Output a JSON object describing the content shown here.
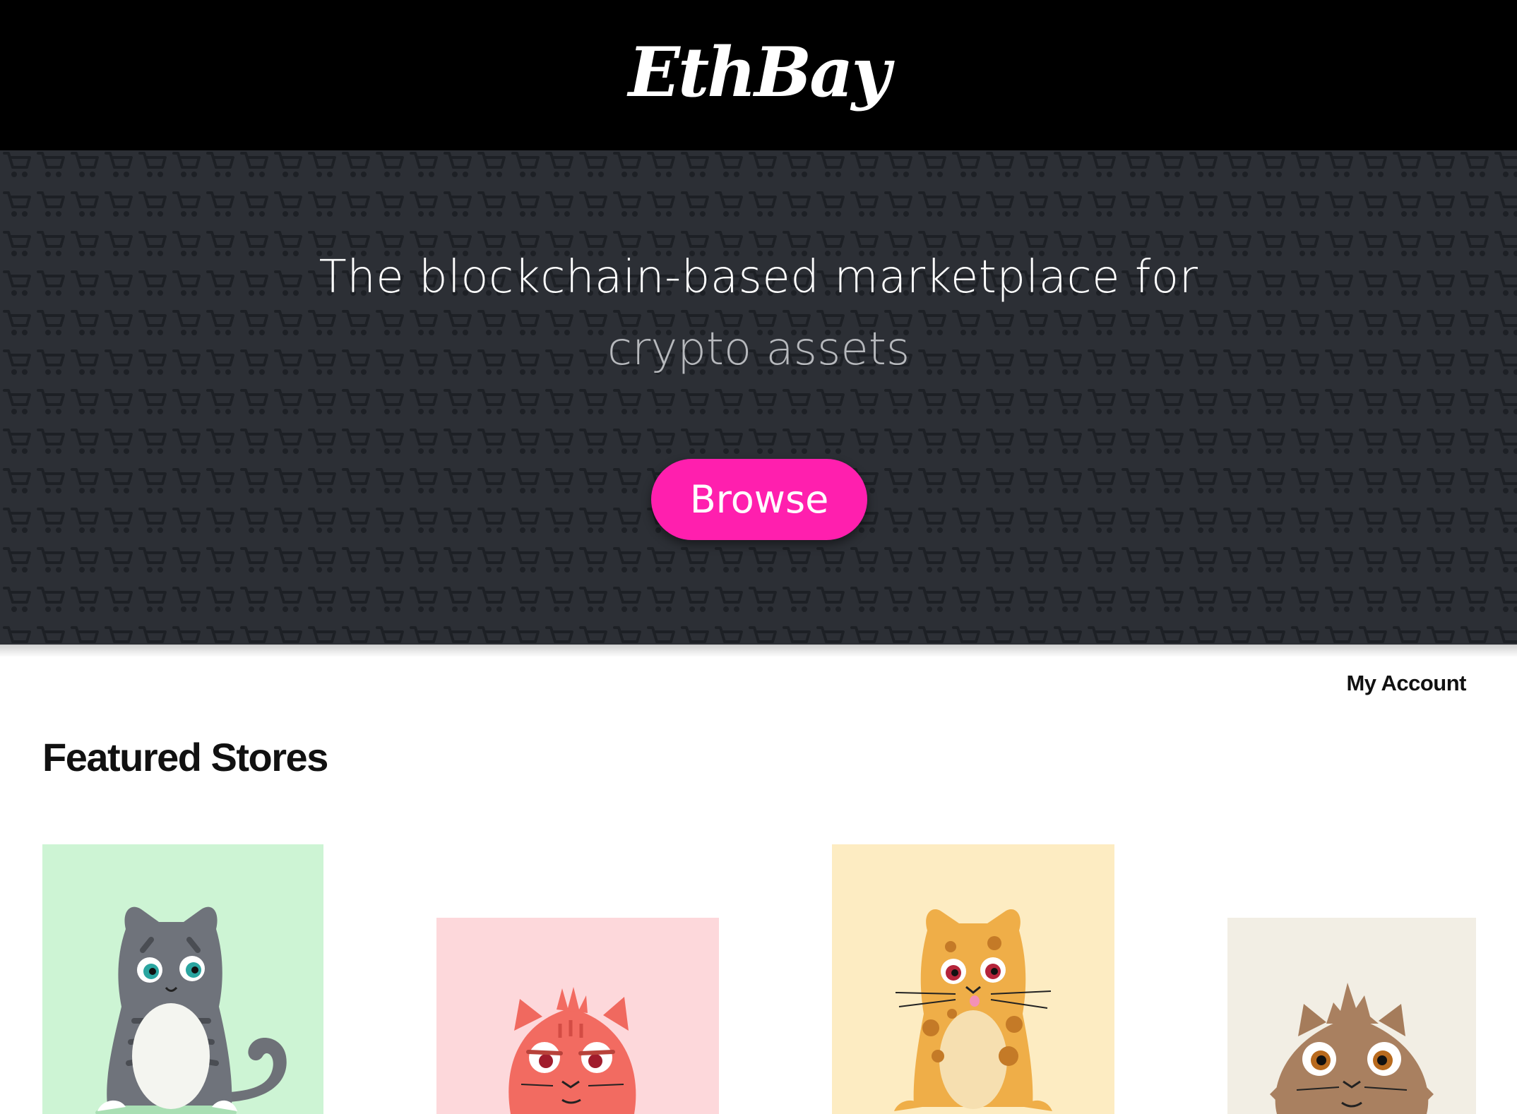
{
  "header": {
    "logo_text": "EthBay"
  },
  "hero": {
    "title": "The blockchain-based marketplace for",
    "subtitle": "crypto assets",
    "browse_label": "Browse",
    "pattern_icon": "shopping-cart-icon"
  },
  "nav": {
    "my_account_label": "My Account"
  },
  "featured": {
    "title": "Featured Stores",
    "stores": [
      {
        "image": "gray-tabby-cat",
        "background": "#cdf4d4"
      },
      {
        "image": "red-grumpy-cat",
        "background": "#fdd8db"
      },
      {
        "image": "orange-spotted-cat",
        "background": "#fdecc2"
      },
      {
        "image": "brown-fluffy-cat",
        "background": "#f2eee4"
      }
    ]
  },
  "colors": {
    "header_bg": "#000000",
    "hero_bg": "#2c2f35",
    "accent": "#ff1fae",
    "text_dark": "#111111"
  }
}
